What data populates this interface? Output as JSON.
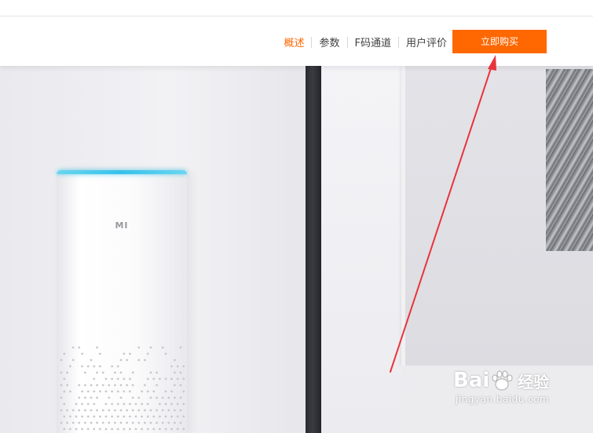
{
  "nav": {
    "items": [
      {
        "label": "概述",
        "active": true
      },
      {
        "label": "参数",
        "active": false
      },
      {
        "label": "F码通道",
        "active": false
      },
      {
        "label": "用户评价",
        "active": false
      }
    ],
    "buy_label": "立即购买"
  },
  "hero": {
    "speaker_logo": "MI"
  },
  "watermark": {
    "brand_left": "Bai",
    "brand_right": "经验",
    "url": "jingyan.baidu.com"
  },
  "colors": {
    "accent": "#ff6700",
    "nav_text": "#424242",
    "speaker_glow": "#36c2ea",
    "annotation_arrow": "#e8343a"
  },
  "icons": {
    "annotation": "red-arrow-icon",
    "watermark_paw": "paw-icon"
  }
}
